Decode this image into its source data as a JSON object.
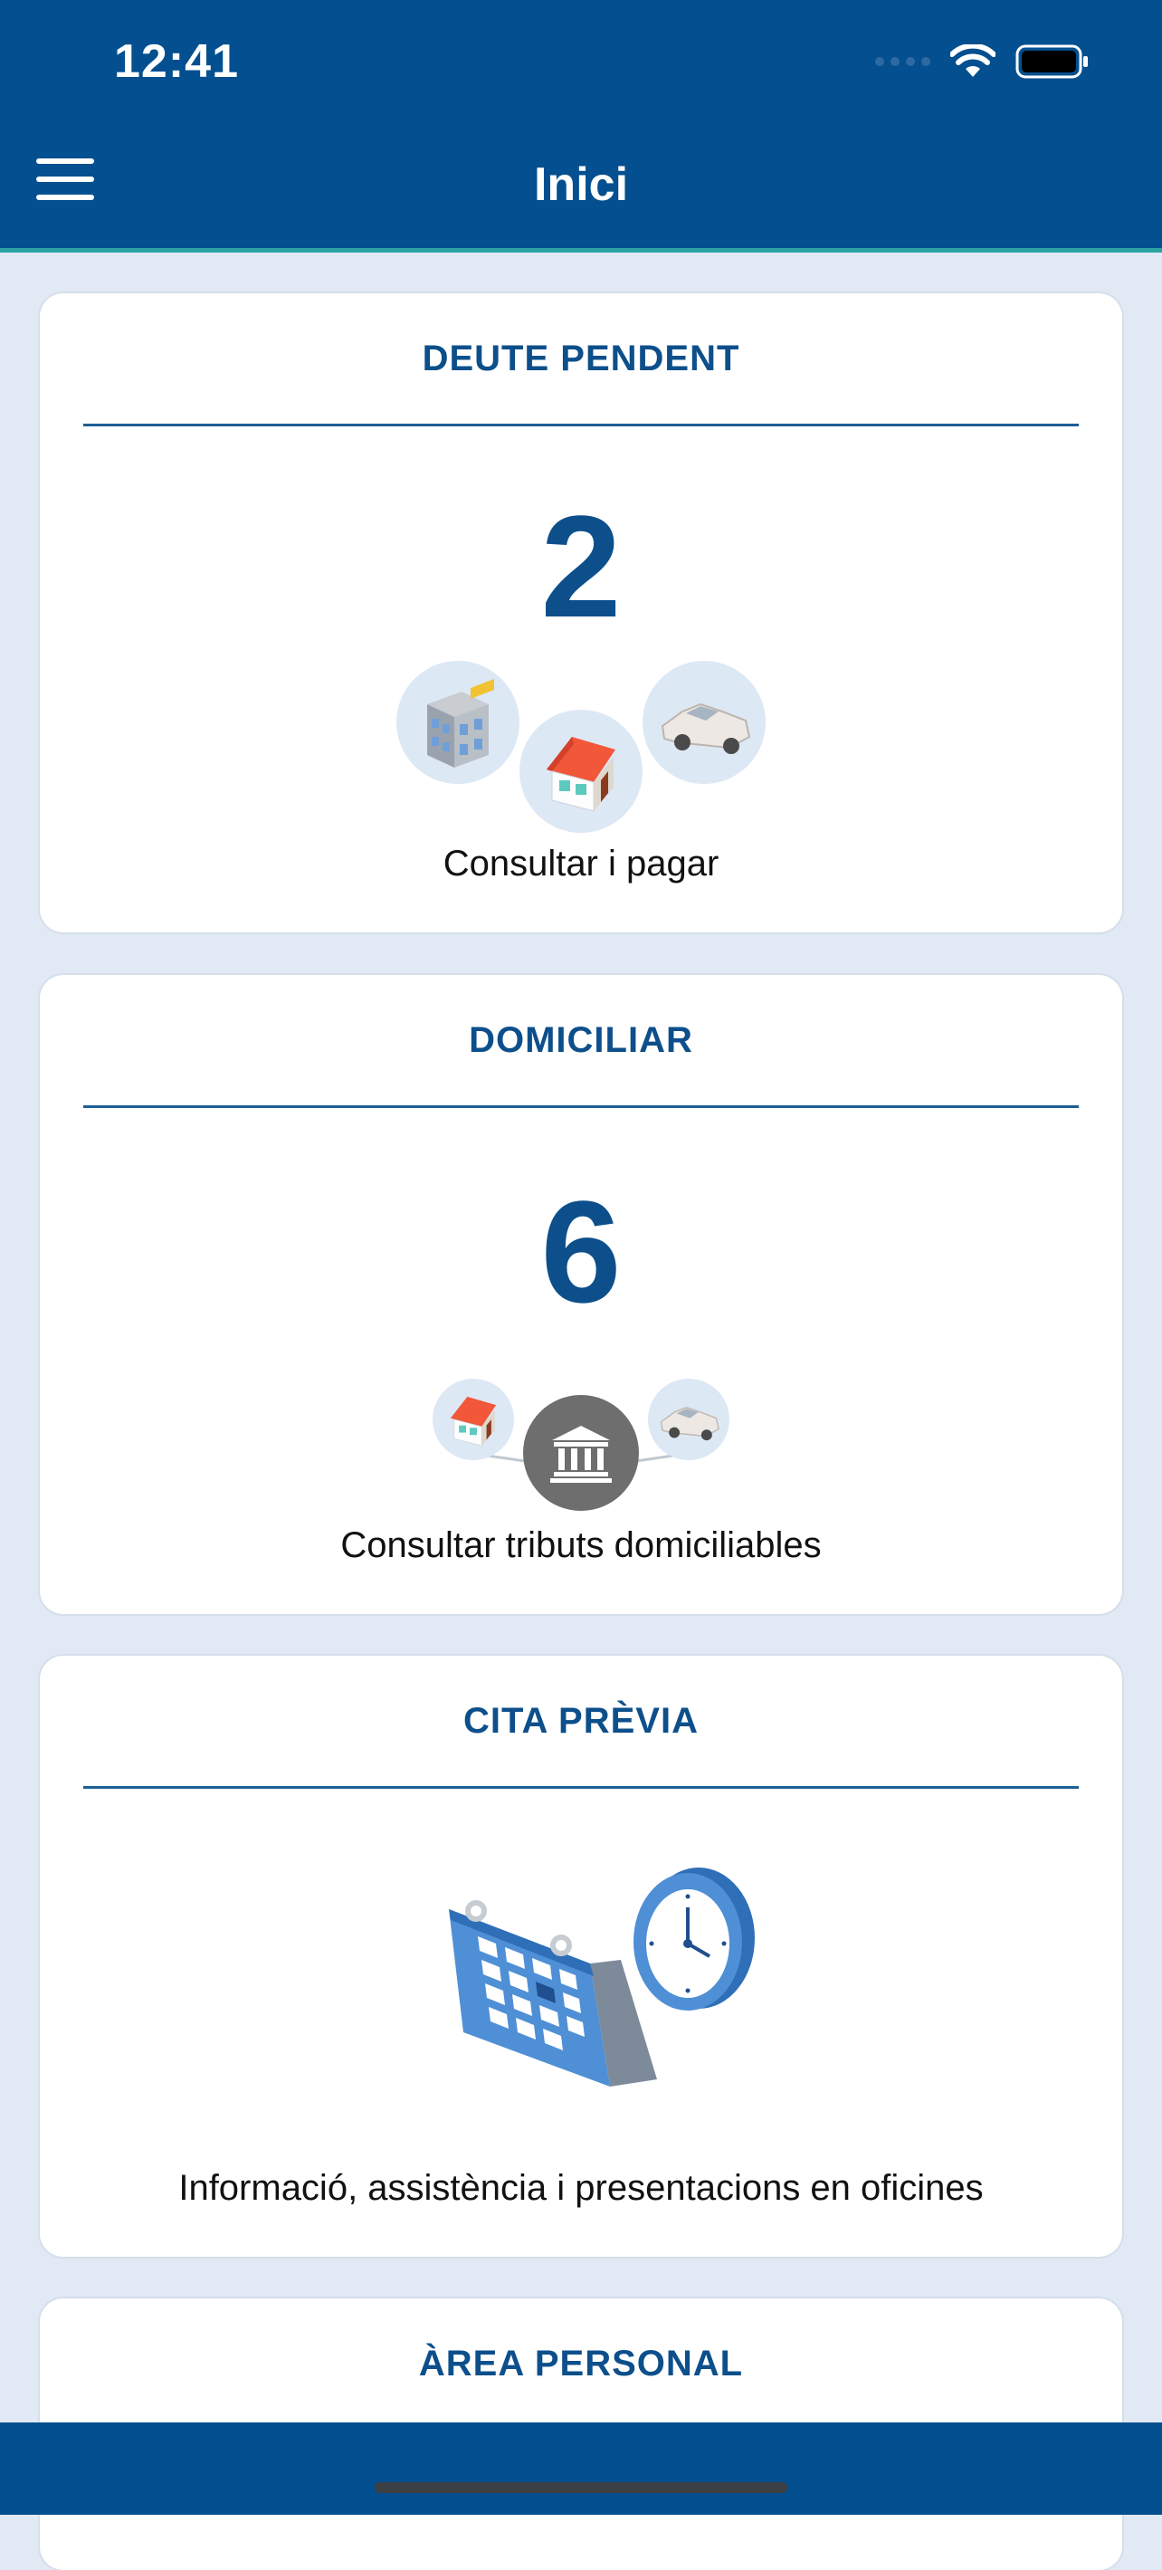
{
  "status_bar": {
    "time": "12:41"
  },
  "nav": {
    "title": "Inici"
  },
  "cards": [
    {
      "title": "DEUTE PENDENT",
      "count": "2",
      "link": "Consultar i pagar"
    },
    {
      "title": "DOMICILIAR",
      "count": "6",
      "link": "Consultar tributs domiciliables"
    },
    {
      "title": "CITA PRÈVIA",
      "link": "Informació, assistència i presentacions en oficines"
    },
    {
      "title": "ÀREA PERSONAL"
    }
  ],
  "icons": {
    "card1": [
      "building-icon",
      "house-icon",
      "car-icon"
    ],
    "card2": [
      "house-icon",
      "bank-icon",
      "car-icon"
    ],
    "card3": [
      "calendar-icon",
      "clock-icon"
    ]
  },
  "colors": {
    "brand": "#034f8f",
    "accent": "#2ba3a3",
    "title": "#0d4f8b",
    "background": "#e1e9f4"
  }
}
